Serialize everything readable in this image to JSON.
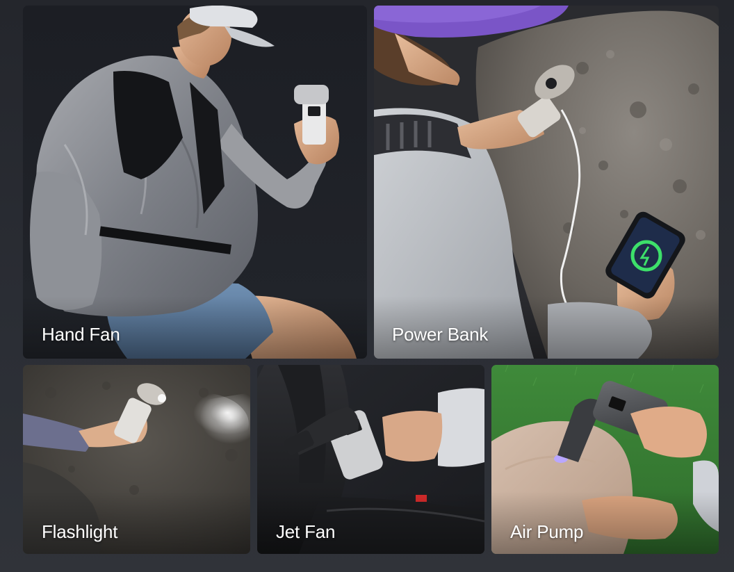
{
  "tiles": [
    {
      "caption": "Hand Fan"
    },
    {
      "caption": "Power Bank"
    },
    {
      "caption": "Flashlight"
    },
    {
      "caption": "Jet Fan"
    },
    {
      "caption": "Air Pump"
    }
  ],
  "colors": {
    "page_background": "#2a2d33",
    "tile_dark_background": "#1d1f25",
    "rock": "#6f6a64",
    "hat_purple": "#7a55c7",
    "grass": "#3f8a3a",
    "caption_text": "#ffffff"
  }
}
